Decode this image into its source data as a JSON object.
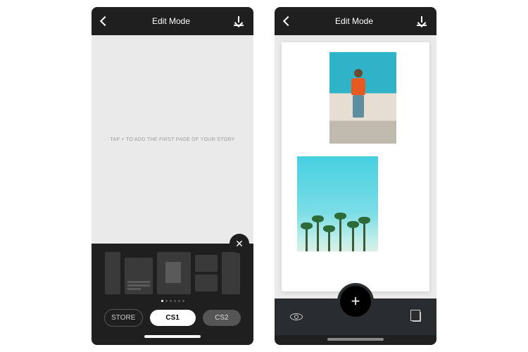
{
  "left": {
    "header": {
      "title": "Edit Mode"
    },
    "hint": "TAP + TO ADD THE FIRST PAGE OF YOUR STORY",
    "tabs": {
      "store": "STORE",
      "cs1": "CS1",
      "cs2": "CS2"
    }
  },
  "right": {
    "header": {
      "title": "Edit Mode"
    },
    "plus": "+"
  }
}
